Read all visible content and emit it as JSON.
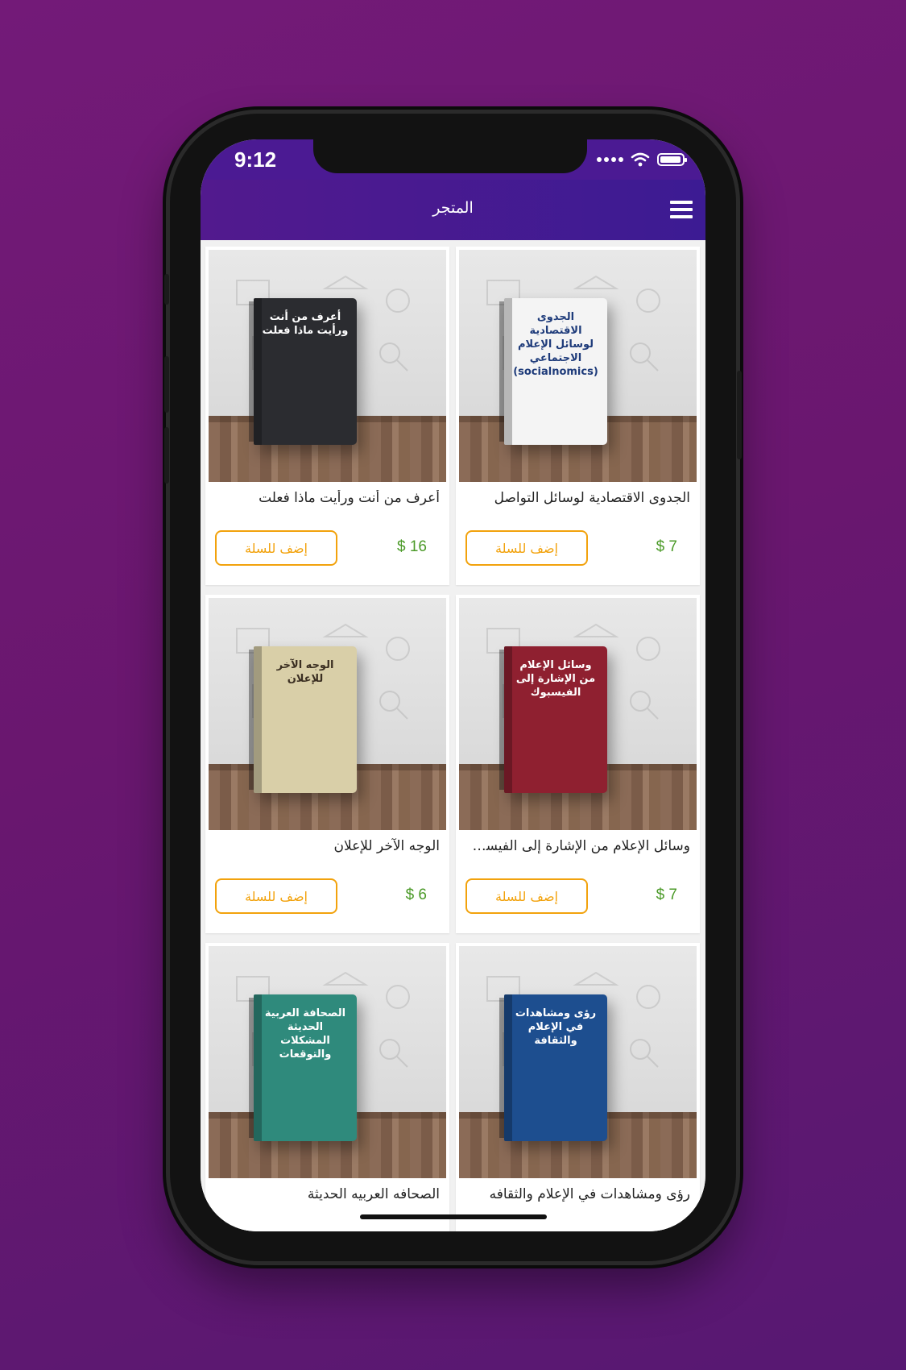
{
  "status_bar": {
    "time": "9:12",
    "icons": [
      "signal-icon",
      "wifi-icon",
      "battery-icon"
    ]
  },
  "app_bar": {
    "title": "المتجر",
    "menu_icon": "hamburger-menu-icon"
  },
  "colors": {
    "header": "#4b1a93",
    "price": "#4b9a28",
    "button": "#f2a20c",
    "background": "#6a176f"
  },
  "products": [
    {
      "title": "الجدوى الاقتصادية لوسائل التواصل",
      "price": "$ 7",
      "button": "إضف للسلة",
      "cover_text": "الجدوى الاقتصادية لوسائل الإعلام الاجتماعي (socialnomics)",
      "cover_color": "#f4f4f4",
      "cover_ink": "#1e3b7a"
    },
    {
      "title": "أعرف من أنت ورأيت ماذا فعلت",
      "price": "$ 16",
      "button": "إضف للسلة",
      "cover_text": "أعرف من أنت ورأيت ماذا فعلت",
      "cover_color": "#2b2c30",
      "cover_ink": "#ffffff"
    },
    {
      "title": "وسائل الإعلام من الإشارة إلى الفيسب...",
      "price": "$ 7",
      "button": "إضف للسلة",
      "cover_text": "وسائل الإعلام من الإشارة إلى الفيسبوك",
      "cover_color": "#8f2030",
      "cover_ink": "#ffffff"
    },
    {
      "title": "الوجه الآخر للإعلان",
      "price": "$ 6",
      "button": "إضف للسلة",
      "cover_text": "الوجه الآخر للإعلان",
      "cover_color": "#d9cfa8",
      "cover_ink": "#3b2f22"
    },
    {
      "title": "رؤى ومشاهدات في الإعلام والثقافه",
      "price": "",
      "button": "",
      "cover_text": "رؤى ومشاهدات في الإعلام والثقافة",
      "cover_color": "#1d4e8f",
      "cover_ink": "#ffffff"
    },
    {
      "title": "الصحافه العربيه الحديثة",
      "price": "",
      "button": "",
      "cover_text": "الصحافة العربية الحديثة المشكلات والتوقعات",
      "cover_color": "#2f8a7c",
      "cover_ink": "#ffffff"
    }
  ]
}
